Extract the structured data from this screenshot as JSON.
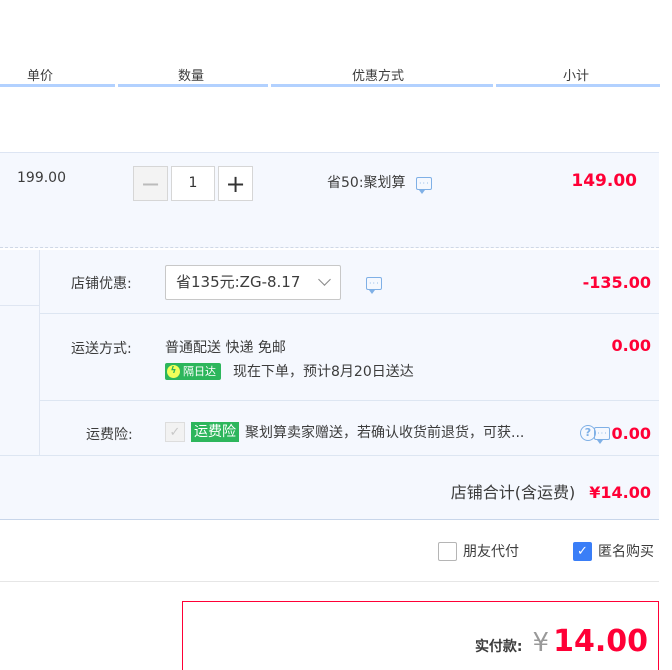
{
  "header": {
    "unit_price": "单价",
    "quantity": "数量",
    "discount": "优惠方式",
    "subtotal": "小计"
  },
  "item": {
    "price": "199.00",
    "quantity": "1",
    "minus": "−",
    "plus": "+",
    "discount_text": "省50:聚划算",
    "subtotal": "149.00"
  },
  "store": {
    "coupon_label": "店铺优惠:",
    "coupon_value": "省135元:ZG-8.17",
    "coupon_amount": "-135.00",
    "shipping_label": "运送方式:",
    "shipping_value": "普通配送 快递 免邮",
    "next_day_badge": "隔日达",
    "delivery_note": "现在下单，预计8月20日送达",
    "shipping_amount": "0.00",
    "insurance_label": "运费险:",
    "insurance_badge": "运费险",
    "insurance_text": "聚划算卖家赠送，若确认收货前退货，可获...",
    "insurance_amount": "0.00",
    "total_label": "店铺合计(含运费)",
    "total_amount": "¥14.00"
  },
  "options": {
    "friend_pay": "朋友代付",
    "anonymous": "匿名购买"
  },
  "payment": {
    "label": "实付款:",
    "currency": "¥",
    "amount": "14.00"
  }
}
